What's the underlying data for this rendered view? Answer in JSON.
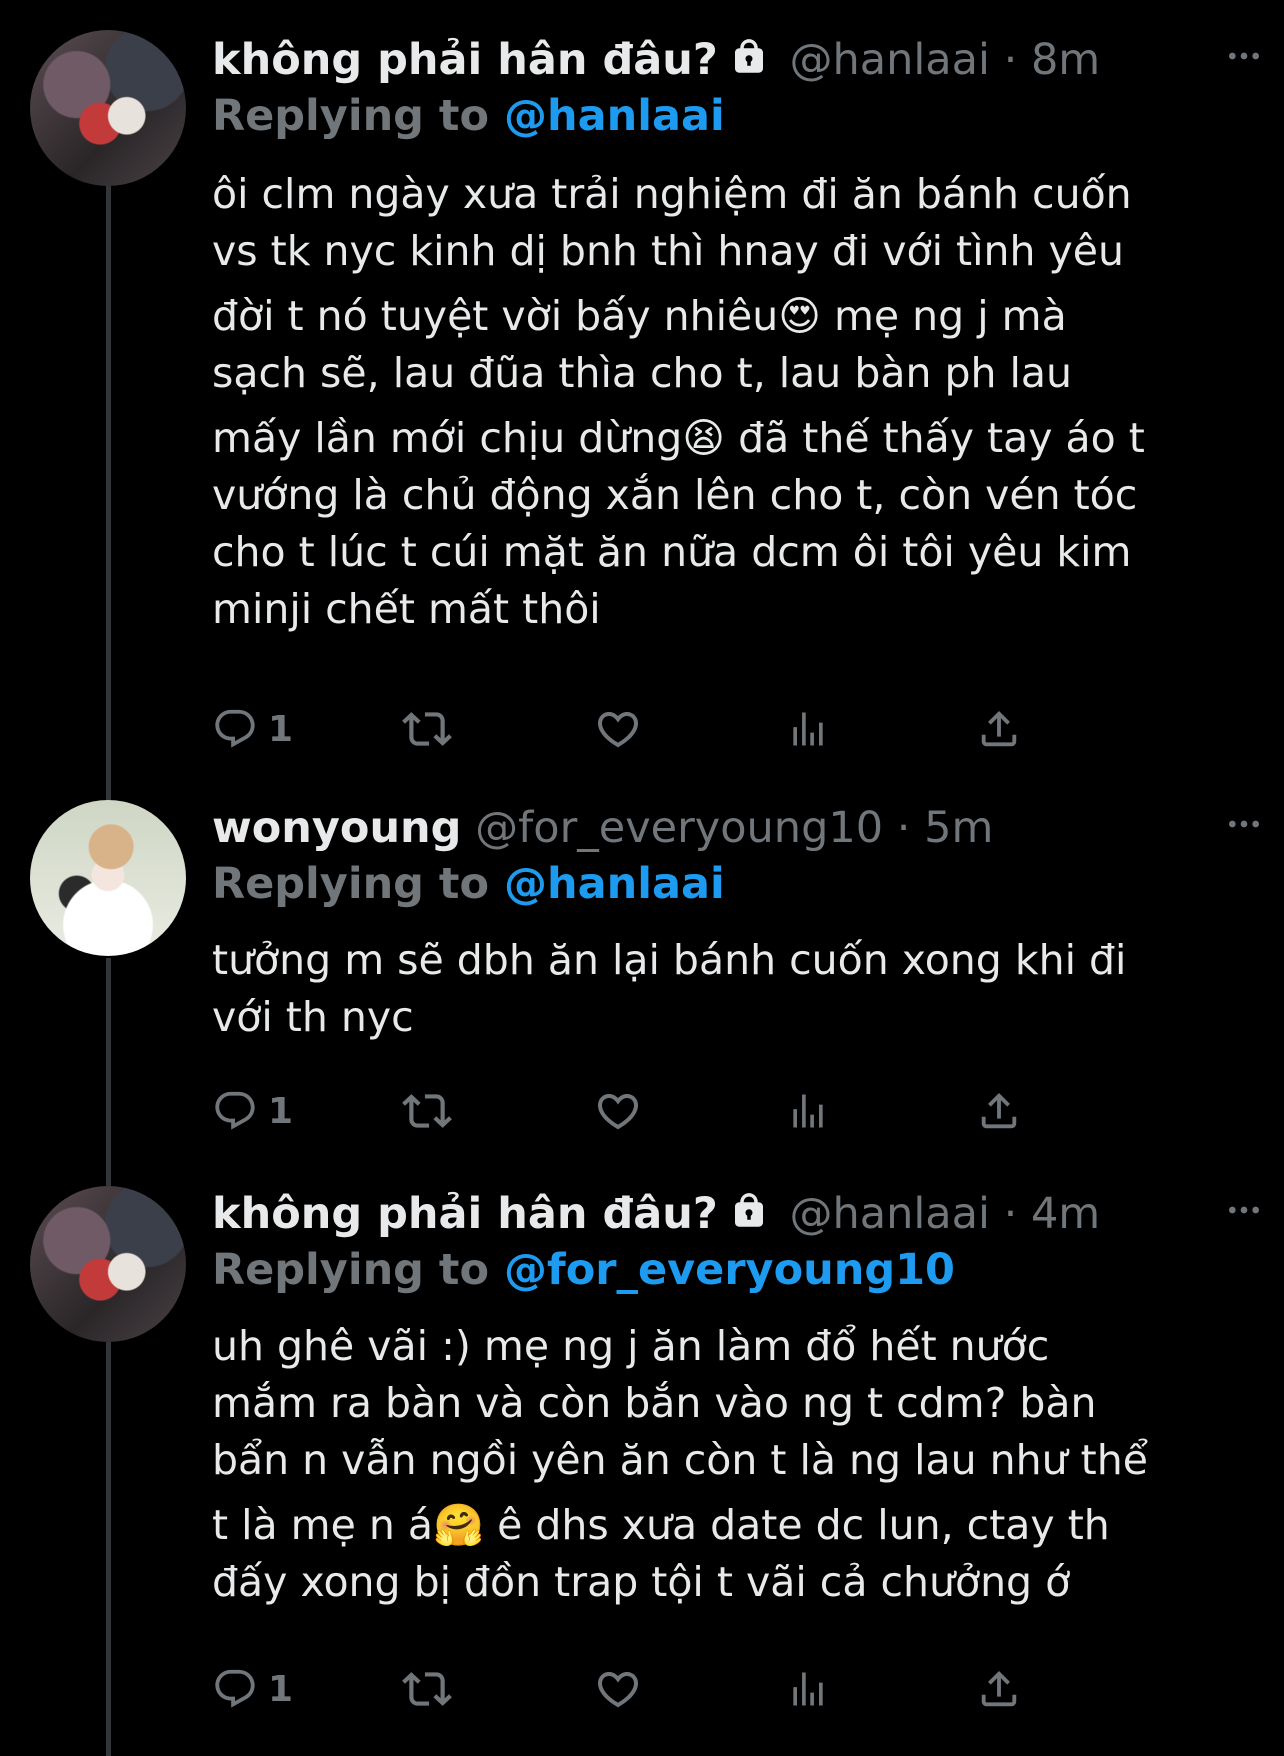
{
  "tweets": [
    {
      "name": "không phải hân đâu?",
      "handle": "@hanlaai",
      "dot": "·",
      "time": "8m",
      "replying_prefix": "Replying to",
      "replying_to": "@hanlaai",
      "lines": [
        "ôi clm ngày xưa trải nghiệm đi ăn bánh cuốn",
        "vs tk nyc kinh dị bnh thì hnay đi với tình yêu",
        "đời t nó tuyệt vời bấy nhiêu😍  mẹ ng j mà",
        "sạch sẽ, lau đũa thìa cho t, lau bàn ph lau",
        "mấy lần mới chịu dừng😫  đã thế thấy tay áo t",
        "vướng là chủ động xắn lên cho t, còn vén tóc",
        "cho t lúc t cúi mặt ăn nữa dcm ôi tôi yêu kim",
        "minji chết mất thôi"
      ],
      "reply_count": "1"
    },
    {
      "name": "wonyoung",
      "handle": "@for_everyoung10",
      "dot": "·",
      "time": "5m",
      "replying_prefix": "Replying to",
      "replying_to": "@hanlaai",
      "lines": [
        "tưởng m sẽ dbh ăn lại bánh cuốn xong khi đi",
        "với th nyc"
      ],
      "reply_count": "1"
    },
    {
      "name": "không phải hân đâu?",
      "handle": "@hanlaai",
      "dot": "·",
      "time": "4m",
      "replying_prefix": "Replying to",
      "replying_to": "@for_everyoung10",
      "lines": [
        "uh ghê vãi :) mẹ ng j ăn làm đổ hết nước",
        "mắm ra bàn và còn bắn vào ng t cdm? bàn",
        "bẩn n vẫn ngồi yên ăn còn t là ng lau như thể",
        "t là mẹ n á🤗  ê dhs xưa date dc lun, ctay th",
        "đấy xong bị đồn trap tội t vãi cả chưởng ớ"
      ],
      "reply_count": "1"
    }
  ],
  "icons": {
    "reply": "reply-icon",
    "retweet": "retweet-icon",
    "like": "heart-icon",
    "views": "views-icon",
    "share": "share-icon",
    "more": "more-icon",
    "lock": "lock-icon"
  },
  "colors": {
    "background": "#000000",
    "text": "#e7e9ea",
    "muted": "#71767b",
    "link": "#1d9bf0",
    "thread_line": "#333639"
  }
}
